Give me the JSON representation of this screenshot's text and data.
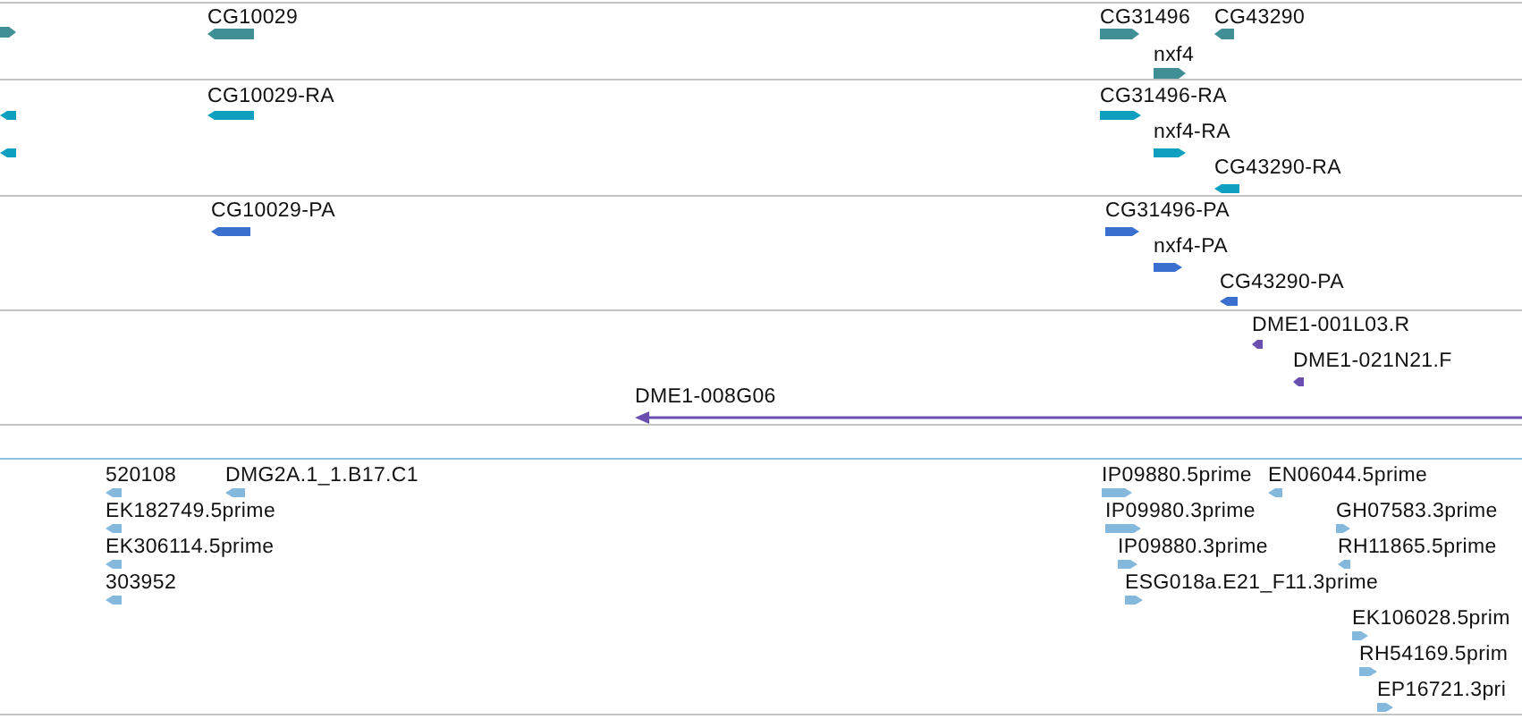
{
  "tracks": [
    {
      "color": "#3f8f94",
      "features": [
        {
          "reverse": false
        },
        {
          "label": "CG10029",
          "reverse": true
        },
        {
          "label": "CG31496",
          "reverse": false
        },
        {
          "label": "CG43290",
          "reverse": true
        },
        {
          "label": "nxf4",
          "reverse": false
        }
      ]
    },
    {
      "color": "#0fa0c0",
      "features": [
        {
          "reverse": true
        },
        {
          "reverse": true
        },
        {
          "label": "CG10029-RA",
          "reverse": true
        },
        {
          "label": "CG31496-RA",
          "reverse": false
        },
        {
          "label": "nxf4-RA",
          "reverse": false
        },
        {
          "label": "CG43290-RA",
          "reverse": true
        }
      ]
    },
    {
      "color": "#3a6fd0",
      "features": [
        {
          "label": "CG10029-PA",
          "reverse": true
        },
        {
          "label": "CG31496-PA",
          "reverse": false
        },
        {
          "label": "nxf4-PA",
          "reverse": false
        },
        {
          "label": "CG43290-PA",
          "reverse": true
        }
      ]
    },
    {
      "color": "#6a4fb0",
      "features": [
        {
          "label": "DME1-001L03.R",
          "reverse": true
        },
        {
          "label": "DME1-021N21.F",
          "reverse": true
        },
        {
          "label": "DME1-008G06",
          "reverse": true
        }
      ]
    },
    {
      "color": "#84b8dc",
      "features": [
        {
          "label": "520108",
          "reverse": true
        },
        {
          "label": "DMG2A.1_1.B17.C1",
          "reverse": true
        },
        {
          "label": "EK182749.5prime",
          "reverse": true
        },
        {
          "label": "EK306114.5prime",
          "reverse": true
        },
        {
          "label": "303952",
          "reverse": true
        },
        {
          "label": "IP09880.5prime",
          "reverse": false
        },
        {
          "label": "EN06044.5prime",
          "reverse": true
        },
        {
          "label": "IP09980.3prime",
          "reverse": false
        },
        {
          "label": "GH07583.3prime",
          "reverse": false
        },
        {
          "label": "IP09880.3prime",
          "reverse": false
        },
        {
          "label": "RH11865.5prime",
          "reverse": true
        },
        {
          "label": "ESG018a.E21_F11.3prime",
          "reverse": false
        },
        {
          "label": "EK106028.5prim",
          "reverse": false
        },
        {
          "label": "RH54169.5prim",
          "reverse": false
        },
        {
          "label": "EP16721.3pri",
          "reverse": false
        }
      ]
    }
  ]
}
